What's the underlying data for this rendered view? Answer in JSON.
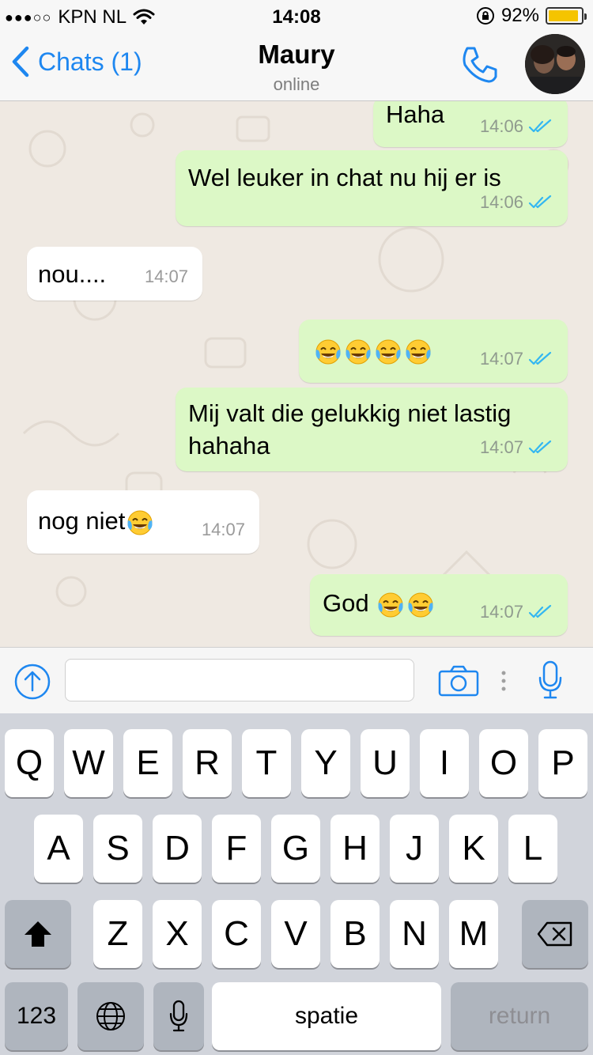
{
  "status_bar": {
    "signal": "●●●○○",
    "carrier": "KPN NL",
    "time": "14:08",
    "battery": "92%",
    "battery_level": 0.92
  },
  "nav": {
    "back_label": "Chats (1)",
    "contact_name": "Maury",
    "contact_status": "online"
  },
  "messages": [
    {
      "dir": "out",
      "text": "Haha",
      "time": "14:06"
    },
    {
      "dir": "out",
      "text": "Wel leuker in chat nu hij er is",
      "time": "14:06"
    },
    {
      "dir": "in",
      "text": "nou....",
      "time": "14:07"
    },
    {
      "dir": "out",
      "text": "",
      "emoji_count": 4,
      "time": "14:07"
    },
    {
      "dir": "out",
      "text": "Mij valt die gelukkig niet lastig",
      "text2": "hahaha",
      "time": "14:07"
    },
    {
      "dir": "in",
      "text": "nog niet",
      "emoji_count": 1,
      "time": "14:07"
    },
    {
      "dir": "out",
      "text": "God",
      "emoji_count": 2,
      "time": "14:07"
    }
  ],
  "input": {
    "placeholder": ""
  },
  "keyboard": {
    "row1": [
      "Q",
      "W",
      "E",
      "R",
      "T",
      "Y",
      "U",
      "I",
      "O",
      "P"
    ],
    "row2": [
      "A",
      "S",
      "D",
      "F",
      "G",
      "H",
      "J",
      "K",
      "L"
    ],
    "row3": [
      "Z",
      "X",
      "C",
      "V",
      "B",
      "N",
      "M"
    ],
    "numbers_label": "123",
    "space_label": "spatie",
    "return_label": "return"
  },
  "colors": {
    "accent": "#1E87F0",
    "outgoing_bubble": "#DCF8C6",
    "incoming_bubble": "#FFFFFF",
    "read_ticks": "#34B7F1"
  }
}
